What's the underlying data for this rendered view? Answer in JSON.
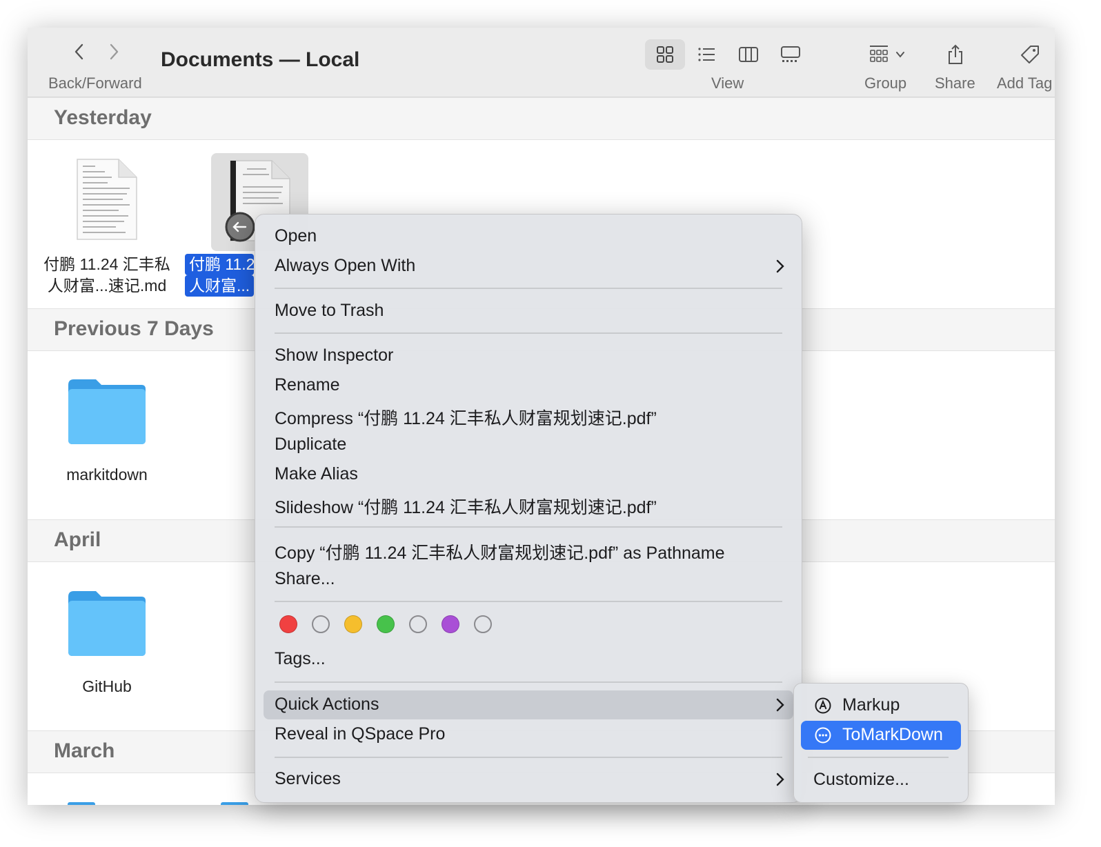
{
  "toolbar": {
    "title": "Documents — Local",
    "back_forward_caption": "Back/Forward",
    "view_caption": "View",
    "group_caption": "Group",
    "share_caption": "Share",
    "add_tag_caption": "Add Tag",
    "active_view": "icon-view"
  },
  "sections": [
    {
      "title": "Yesterday"
    },
    {
      "title": "Previous 7 Days"
    },
    {
      "title": "April"
    },
    {
      "title": "March"
    }
  ],
  "files": {
    "md_file": {
      "line1": "付鹏 11.24 汇丰私",
      "line2": "人财富...速记.md"
    },
    "pdf_file": {
      "line1": "付鹏 11.2",
      "line2": "人财富..."
    },
    "folder1": {
      "label": "markitdown"
    },
    "folder2": {
      "label": "GitHub"
    }
  },
  "context_menu": {
    "open": "Open",
    "always_open_with": "Always Open With",
    "move_to_trash": "Move to Trash",
    "show_inspector": "Show Inspector",
    "rename": "Rename",
    "compress": "Compress “付鹏 11.24 汇丰私人财富规划速记.pdf”",
    "duplicate": "Duplicate",
    "make_alias": "Make Alias",
    "slideshow": "Slideshow “付鹏 11.24 汇丰私人财富规划速记.pdf”",
    "copy_pathname": "Copy “付鹏 11.24 汇丰私人财富规划速记.pdf” as Pathname",
    "share": "Share...",
    "tags": "Tags...",
    "quick_actions": "Quick Actions",
    "reveal_qspace": "Reveal in QSpace Pro",
    "services": "Services",
    "tag_colors": [
      "#f04141",
      "none",
      "#f5be2d",
      "#47c24b",
      "none",
      "#a94fd6",
      "none"
    ]
  },
  "submenu": {
    "markup": "Markup",
    "tomarkdown": "ToMarkDown",
    "customize": "Customize..."
  }
}
